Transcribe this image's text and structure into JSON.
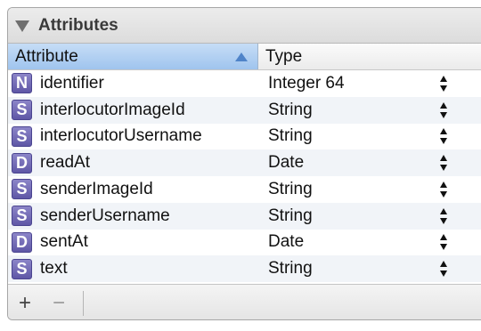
{
  "panel": {
    "title": "Attributes"
  },
  "columns": {
    "attribute": "Attribute",
    "type": "Type"
  },
  "rows": [
    {
      "badge": "N",
      "name": "identifier",
      "type": "Integer 64"
    },
    {
      "badge": "S",
      "name": "interlocutorImageId",
      "type": "String"
    },
    {
      "badge": "S",
      "name": "interlocutorUsername",
      "type": "String"
    },
    {
      "badge": "D",
      "name": "readAt",
      "type": "Date"
    },
    {
      "badge": "S",
      "name": "senderImageId",
      "type": "String"
    },
    {
      "badge": "S",
      "name": "senderUsername",
      "type": "String"
    },
    {
      "badge": "D",
      "name": "sentAt",
      "type": "Date"
    },
    {
      "badge": "S",
      "name": "text",
      "type": "String"
    }
  ],
  "toolbar": {
    "add": "+",
    "remove": "−"
  },
  "icons": {
    "disclosure": "disclosure-triangle-icon",
    "sort": "sort-ascending-icon",
    "stepper": "up-down-stepper-icon"
  },
  "colors": {
    "header_selected": "#9fc4ee",
    "badge": "#6f68b6"
  }
}
